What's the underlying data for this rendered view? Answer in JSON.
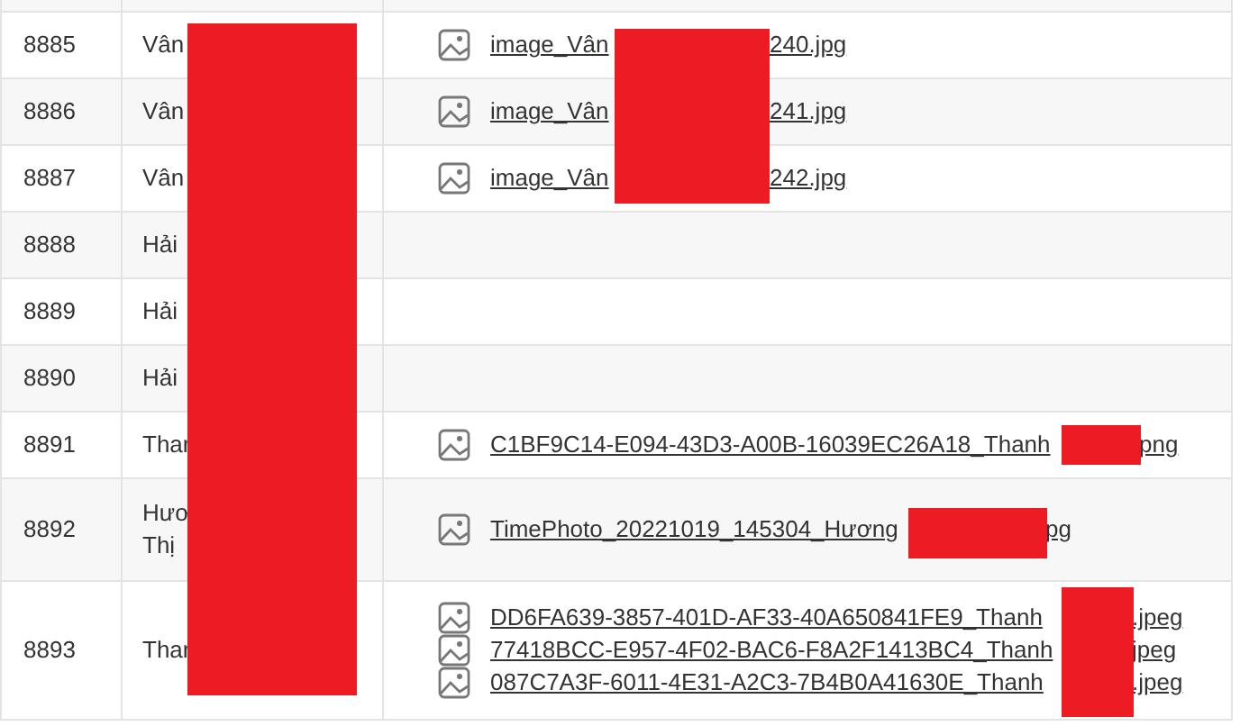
{
  "rows": [
    {
      "id": "8885",
      "name": [
        "Vân"
      ],
      "files": [
        {
          "prefix": "image_Vân",
          "suffix": "240.jpg"
        }
      ]
    },
    {
      "id": "8886",
      "name": [
        "Vân"
      ],
      "files": [
        {
          "prefix": "image_Vân",
          "suffix": "241.jpg"
        }
      ]
    },
    {
      "id": "8887",
      "name": [
        "Vân"
      ],
      "files": [
        {
          "prefix": "image_Vân",
          "suffix": "242.jpg"
        }
      ]
    },
    {
      "id": "8888",
      "name": [
        "Hải"
      ],
      "files": []
    },
    {
      "id": "8889",
      "name": [
        "Hải"
      ],
      "files": []
    },
    {
      "id": "8890",
      "name": [
        "Hải"
      ],
      "files": []
    },
    {
      "id": "8891",
      "name": [
        "Thar"
      ],
      "files": [
        {
          "prefix": "C1BF9C14-E094-43D3-A00B-16039EC26A18_Thanh",
          "suffix": "png"
        }
      ]
    },
    {
      "id": "8892",
      "name": [
        "Hươ",
        "Thị"
      ],
      "files": [
        {
          "prefix": "TimePhoto_20221019_145304_Hương",
          "suffix": "pg"
        }
      ]
    },
    {
      "id": "8893",
      "name": [
        "Thar"
      ],
      "files": [
        {
          "prefix": "DD6FA639-3857-401D-AF33-40A650841FE9_Thanh",
          "suffix": ".jpeg"
        },
        {
          "prefix": "77418BCC-E957-4F02-BAC6-F8A2F1413BC4_Thanh",
          "suffix": "jpeg"
        },
        {
          "prefix": "087C7A3F-6011-4E31-A2C3-7B4B0A41630E_Thanh",
          "suffix": ".jpeg"
        }
      ]
    }
  ]
}
